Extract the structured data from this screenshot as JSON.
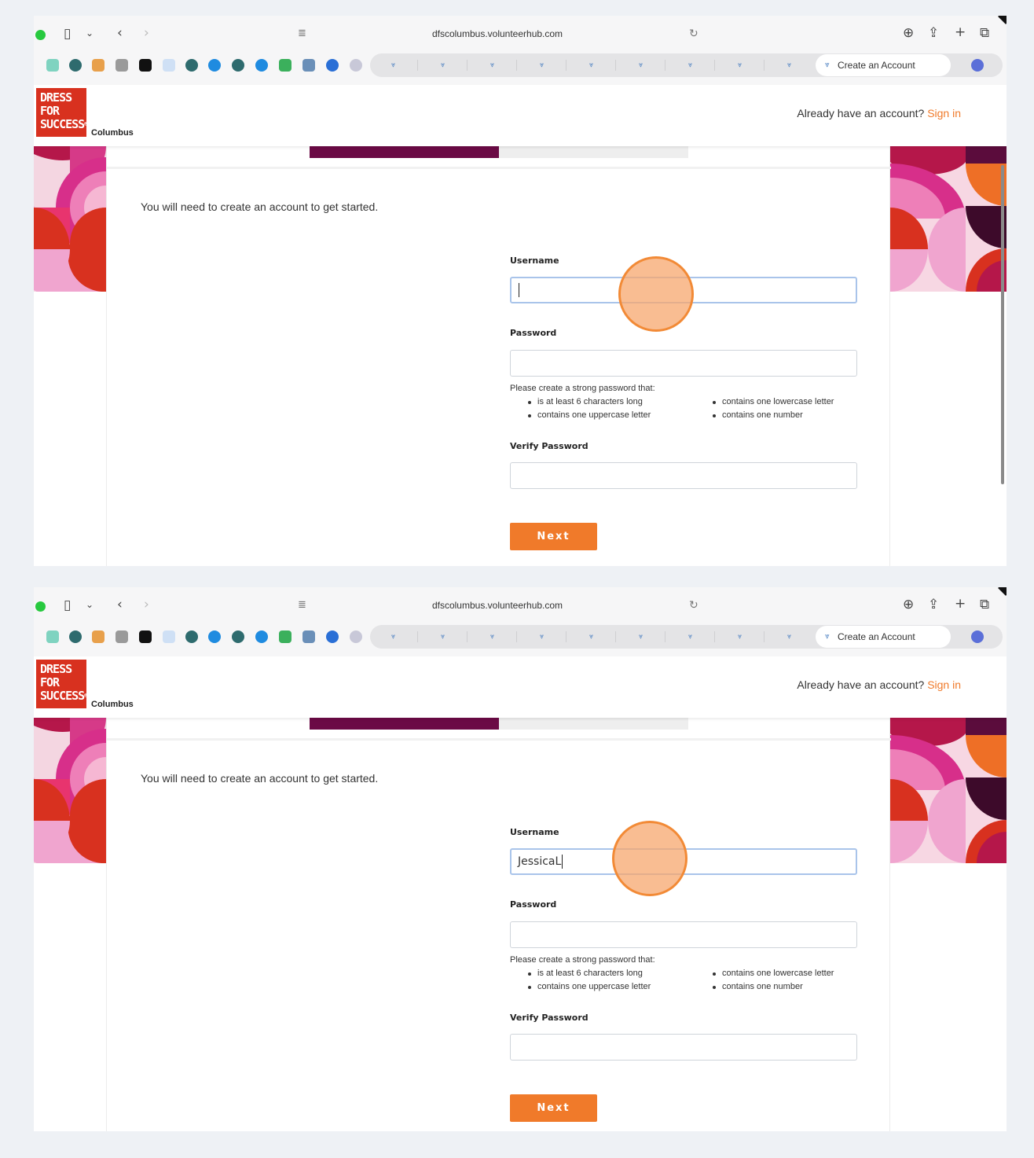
{
  "browser": {
    "url": "dfscolumbus.volunteerhub.com",
    "active_tab": "Create an Account"
  },
  "site": {
    "logo_lines": [
      "DRESS",
      "FOR",
      "SUCCESS"
    ],
    "logo_mark": "®",
    "location": "Columbus",
    "signin_prompt": "Already have an account?",
    "signin_link": "Sign in"
  },
  "form": {
    "intro": "You will need to create an account to get started.",
    "username_label": "Username",
    "password_label": "Password",
    "password_hint": "Please create a strong password that:",
    "rules_left": [
      "is at least 6 characters long",
      "contains one uppercase letter"
    ],
    "rules_right": [
      "contains one lowercase letter",
      "contains one number"
    ],
    "verify_label": "Verify Password",
    "next_label": "Next",
    "progress": 0.5
  },
  "screens": [
    {
      "username_value": ""
    },
    {
      "username_value": "JessicaL"
    }
  ],
  "colors": {
    "accent": "#f07a2a",
    "brand_red": "#d8311f",
    "progress": "#6b0a45"
  }
}
